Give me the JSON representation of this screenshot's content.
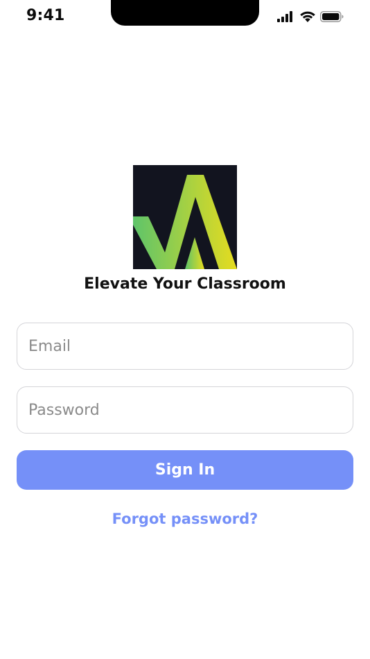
{
  "status_bar": {
    "time": "9:41",
    "icons": [
      "cellular-signal-icon",
      "wifi-icon",
      "battery-icon"
    ]
  },
  "logo": {
    "name": "app-logo",
    "background_color": "#12141f",
    "gradient_colors": [
      "#5ec46a",
      "#e6dc1f"
    ]
  },
  "app": {
    "title": "Elevate Your Classroom"
  },
  "form": {
    "email_placeholder": "Email",
    "email_value": "",
    "password_placeholder": "Password",
    "password_value": "",
    "signin_label": "Sign In",
    "forgot_label": "Forgot password?"
  },
  "colors": {
    "primary": "#7590f8",
    "link": "#7590f8",
    "field_border": "#d4d4d8",
    "text": "#111111"
  }
}
